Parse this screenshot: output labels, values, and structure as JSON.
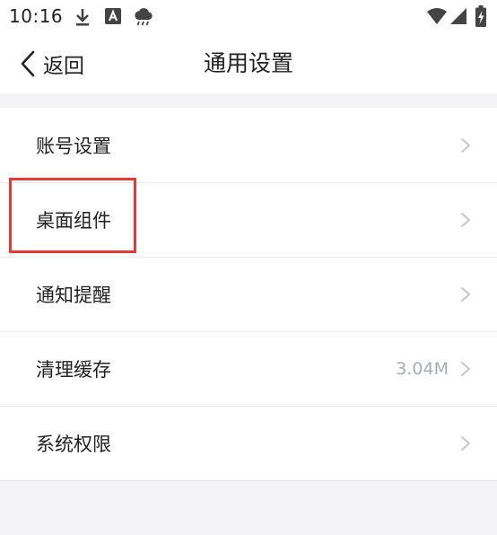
{
  "status_bar": {
    "time": "10:16",
    "icons": [
      "download-icon",
      "keyboard-a-icon",
      "rain-cloud-icon",
      "wifi-icon",
      "signal-icon",
      "battery-charging-icon"
    ]
  },
  "header": {
    "back_label": "返回",
    "title": "通用设置"
  },
  "settings": {
    "items": [
      {
        "label": "账号设置",
        "value": ""
      },
      {
        "label": "桌面组件",
        "value": ""
      },
      {
        "label": "通知提醒",
        "value": ""
      },
      {
        "label": "清理缓存",
        "value": "3.04M"
      },
      {
        "label": "系统权限",
        "value": ""
      }
    ]
  },
  "colors": {
    "highlight": "#e53935",
    "secondary_text": "#a7abb3",
    "background": "#f4f4f6"
  }
}
